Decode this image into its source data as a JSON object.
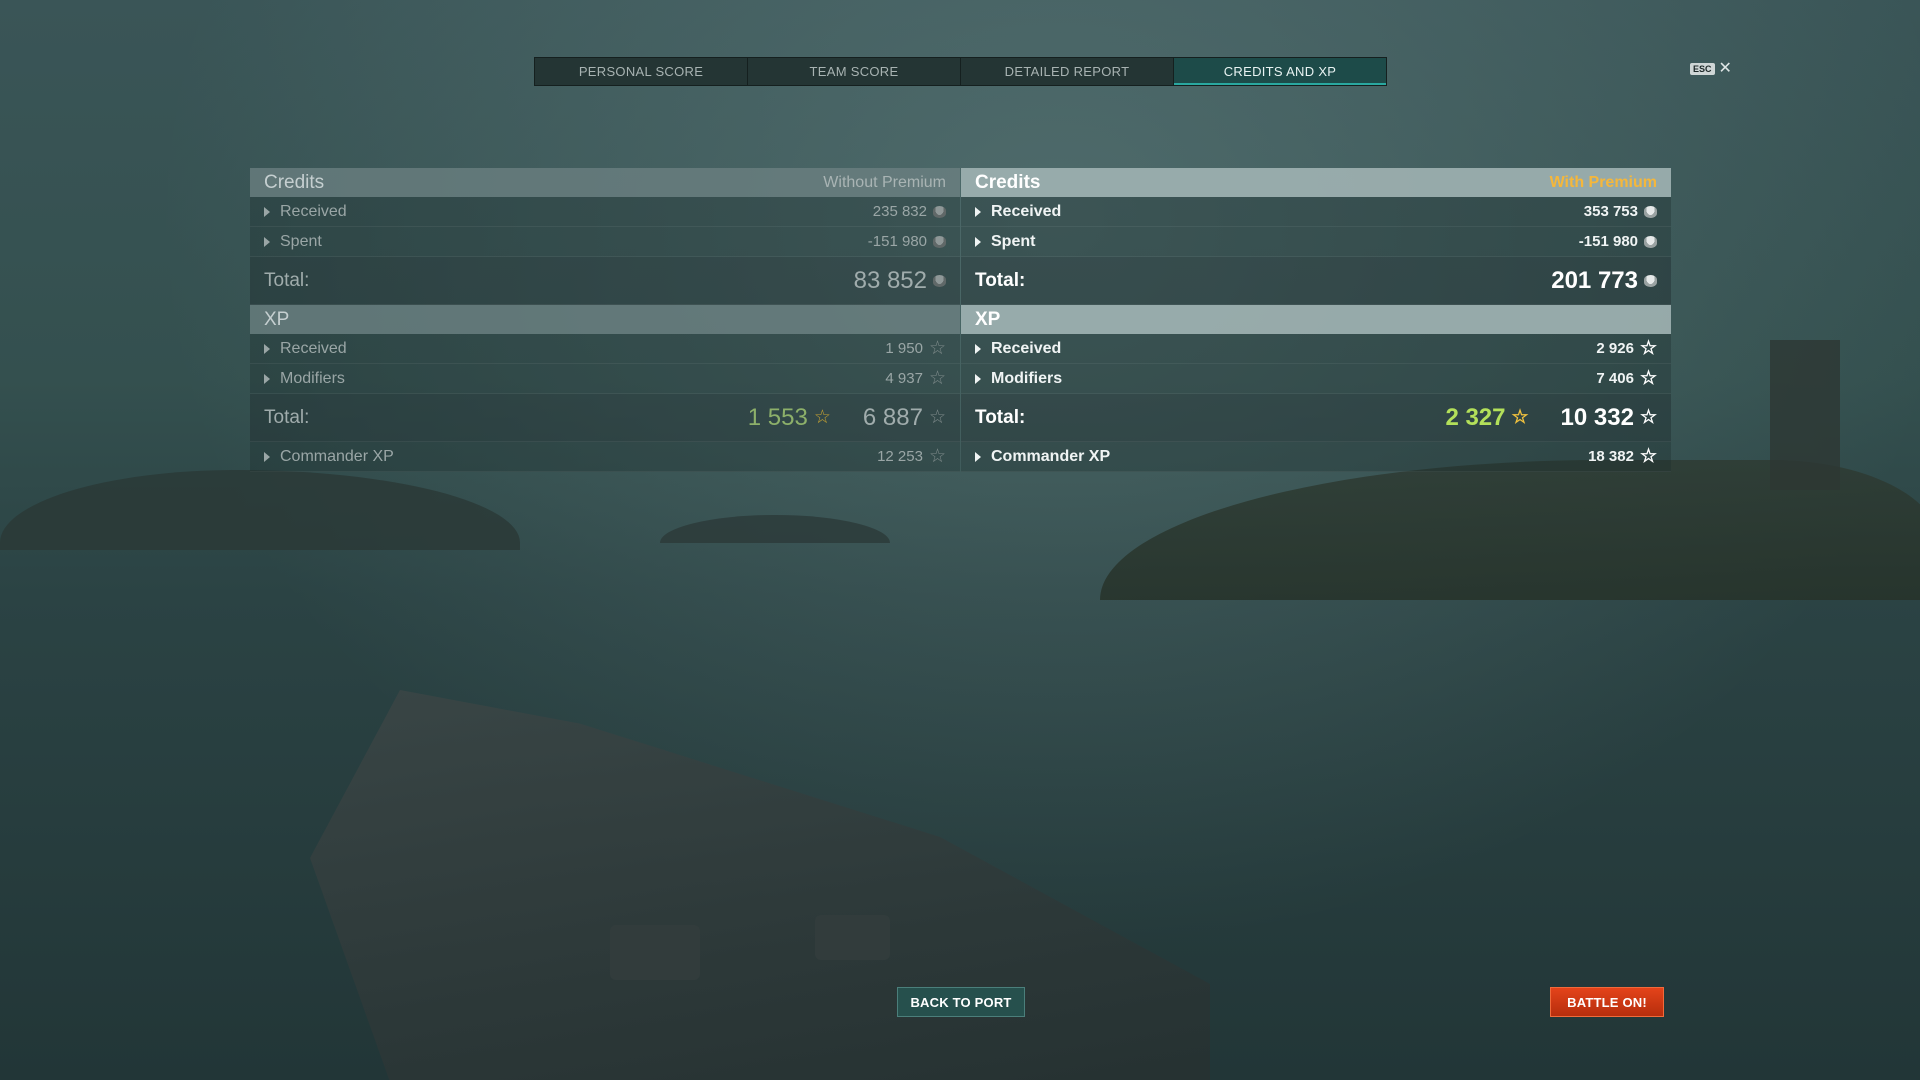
{
  "tabs": [
    {
      "label": "PERSONAL SCORE"
    },
    {
      "label": "TEAM SCORE"
    },
    {
      "label": "DETAILED REPORT"
    },
    {
      "label": "CREDITS AND XP",
      "active": true
    }
  ],
  "close": {
    "key": "ESC",
    "icon": "close-icon"
  },
  "without_premium": {
    "title": "Credits",
    "subtitle": "Without Premium",
    "credits": {
      "received_label": "Received",
      "received": "235 832",
      "spent_label": "Spent",
      "spent": "-151 980",
      "total_label": "Total:",
      "total": "83 852"
    },
    "xp": {
      "title": "XP",
      "received_label": "Received",
      "received": "1 950",
      "modifiers_label": "Modifiers",
      "modifiers": "4 937",
      "total_label": "Total:",
      "total_free": "1 553",
      "total": "6 887"
    },
    "commander_label": "Commander XP",
    "commander": "12 253"
  },
  "with_premium": {
    "title": "Credits",
    "subtitle": "With Premium",
    "credits": {
      "received_label": "Received",
      "received": "353 753",
      "spent_label": "Spent",
      "spent": "-151 980",
      "total_label": "Total:",
      "total": "201 773"
    },
    "xp": {
      "title": "XP",
      "received_label": "Received",
      "received": "2 926",
      "modifiers_label": "Modifiers",
      "modifiers": "7 406",
      "total_label": "Total:",
      "total_free": "2 327",
      "total": "10 332"
    },
    "commander_label": "Commander XP",
    "commander": "18 382"
  },
  "buttons": {
    "back_to_port": "BACK TO PORT",
    "battle_on": "BATTLE ON!"
  },
  "colors": {
    "premium": "#f5b73b",
    "free_xp": "#b3e05a",
    "battle": "#d33a13"
  }
}
